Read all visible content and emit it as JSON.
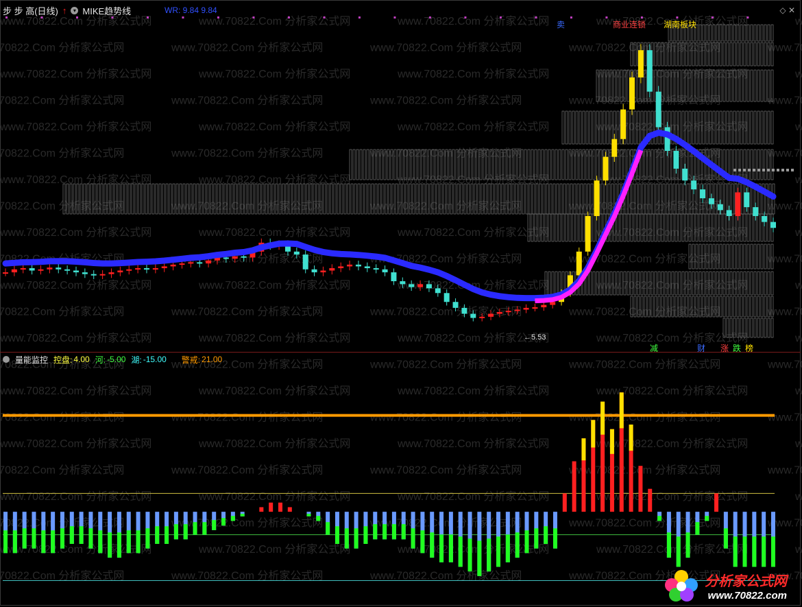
{
  "header": {
    "stock_name": "步 步 高(日线)",
    "indicator_name": "MIKE趋势线",
    "wr_text": "WR: 9.84 9.84"
  },
  "markers": {
    "sell": "卖",
    "business": "商业连锁",
    "hunan": "湖南板块",
    "low_price": "5.53",
    "bottom_tags": [
      "减",
      "财",
      "涨",
      "跌",
      "榜"
    ]
  },
  "sub_header": {
    "name": "量能监控",
    "items": [
      {
        "label": "控盘:",
        "value": "4.00",
        "color": "#ffff40"
      },
      {
        "label": "河:",
        "value": "-5.00",
        "color": "#40ff40"
      },
      {
        "label": "湖:",
        "value": "-15.00",
        "color": "#40ffff"
      },
      {
        "label": "警戒:",
        "value": "21.00",
        "color": "#ff9a00"
      }
    ]
  },
  "watermark": {
    "text": "www.70822.Com 分析家公式网"
  },
  "logo": {
    "cn": "分析家公式网",
    "url": "www.70822.com"
  },
  "colors": {
    "up": "#ff2020",
    "down": "#40e0d0",
    "yellow": "#ffe000",
    "mike": "#2a2aff",
    "magenta": "#ff20ff",
    "orange": "#ff9a00",
    "blue_bar": "#6a9aff",
    "green_bar": "#20ff20"
  },
  "chart_data": [
    {
      "type": "candlestick",
      "title": "步 步 高(日线)",
      "series_name": "MIKE趋势线",
      "annotations": [
        "5.53"
      ],
      "close": [
        6.55,
        6.6,
        6.62,
        6.58,
        6.6,
        6.63,
        6.6,
        6.58,
        6.55,
        6.52,
        6.5,
        6.52,
        6.55,
        6.58,
        6.6,
        6.62,
        6.6,
        6.62,
        6.65,
        6.68,
        6.7,
        6.72,
        6.7,
        6.75,
        6.8,
        6.78,
        6.82,
        6.8,
        6.9,
        7.05,
        7.0,
        7.02,
        6.9,
        6.85,
        6.6,
        6.55,
        6.58,
        6.62,
        6.65,
        6.68,
        6.65,
        6.62,
        6.6,
        6.55,
        6.4,
        6.35,
        6.3,
        6.35,
        6.28,
        6.2,
        6.05,
        5.95,
        5.85,
        5.78,
        5.8,
        5.85,
        5.88,
        5.9,
        5.92,
        5.95,
        5.96,
        6.0,
        6.05,
        6.2,
        6.5,
        6.9,
        7.5,
        8.1,
        8.5,
        8.8,
        9.3,
        9.84,
        10.3,
        9.6,
        9.0,
        8.6,
        8.3,
        8.1,
        7.95,
        7.8,
        7.7,
        7.6,
        7.5,
        7.9,
        7.65,
        7.5,
        7.4,
        7.3
      ]
    },
    {
      "type": "bar",
      "title": "量能监控",
      "reference_lines": {
        "控盘": 4.0,
        "河": -5.0,
        "湖": -15.0,
        "警戒": 21.0
      },
      "values": [
        -9,
        -9,
        -8,
        -8,
        -9,
        -9,
        -8,
        -7,
        -7,
        -8,
        -9,
        -10,
        -10,
        -9,
        -9,
        -8,
        -7,
        -7,
        -6,
        -6,
        -5,
        -5,
        -4,
        -3,
        -2,
        -1,
        0,
        1,
        2,
        2,
        1,
        0,
        -1,
        -2,
        -5,
        -7,
        -8,
        -8,
        -7,
        -6,
        -6,
        -6,
        -6,
        -8,
        -9,
        -10,
        -11,
        -11,
        -12,
        -13,
        -14,
        -13,
        -12,
        -11,
        -10,
        -9,
        -8,
        -7,
        -8,
        4,
        11,
        16,
        20,
        24,
        18,
        26,
        19,
        10,
        5,
        -2,
        -10,
        -12,
        -10,
        -5,
        -2,
        4,
        -8,
        -12,
        -12,
        -12,
        -12,
        -12
      ]
    }
  ]
}
